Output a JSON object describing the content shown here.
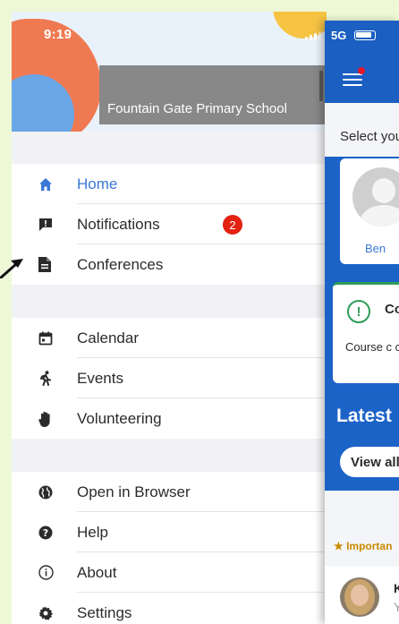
{
  "status_bar": {
    "time": "9:19",
    "network": "5G"
  },
  "drawer": {
    "school_name": "Fountain Gate Primary School",
    "groups": [
      [
        {
          "label": "Home",
          "icon": "home-icon",
          "active": true
        },
        {
          "label": "Notifications",
          "icon": "notification-icon",
          "badge": "2"
        },
        {
          "label": "Conferences",
          "icon": "document-icon"
        }
      ],
      [
        {
          "label": "Calendar",
          "icon": "calendar-icon"
        },
        {
          "label": "Events",
          "icon": "running-icon"
        },
        {
          "label": "Volunteering",
          "icon": "hand-icon"
        }
      ],
      [
        {
          "label": "Open in Browser",
          "icon": "globe-icon"
        },
        {
          "label": "Help",
          "icon": "help-icon"
        },
        {
          "label": "About",
          "icon": "info-icon"
        },
        {
          "label": "Settings",
          "icon": "gear-icon"
        }
      ]
    ]
  },
  "main": {
    "select_prompt": "Select you",
    "child_name": "Ben",
    "notice_title": "Co",
    "notice_body": "Course c completi",
    "latest_heading": "Latest",
    "view_all_label": "View all",
    "important_label": "Importan",
    "feed_name": "K",
    "feed_sub": "Y"
  },
  "colors": {
    "accent": "#3a78d6",
    "app_bar": "#1a5fc1",
    "badge": "#e32212",
    "success": "#2e9c59"
  }
}
